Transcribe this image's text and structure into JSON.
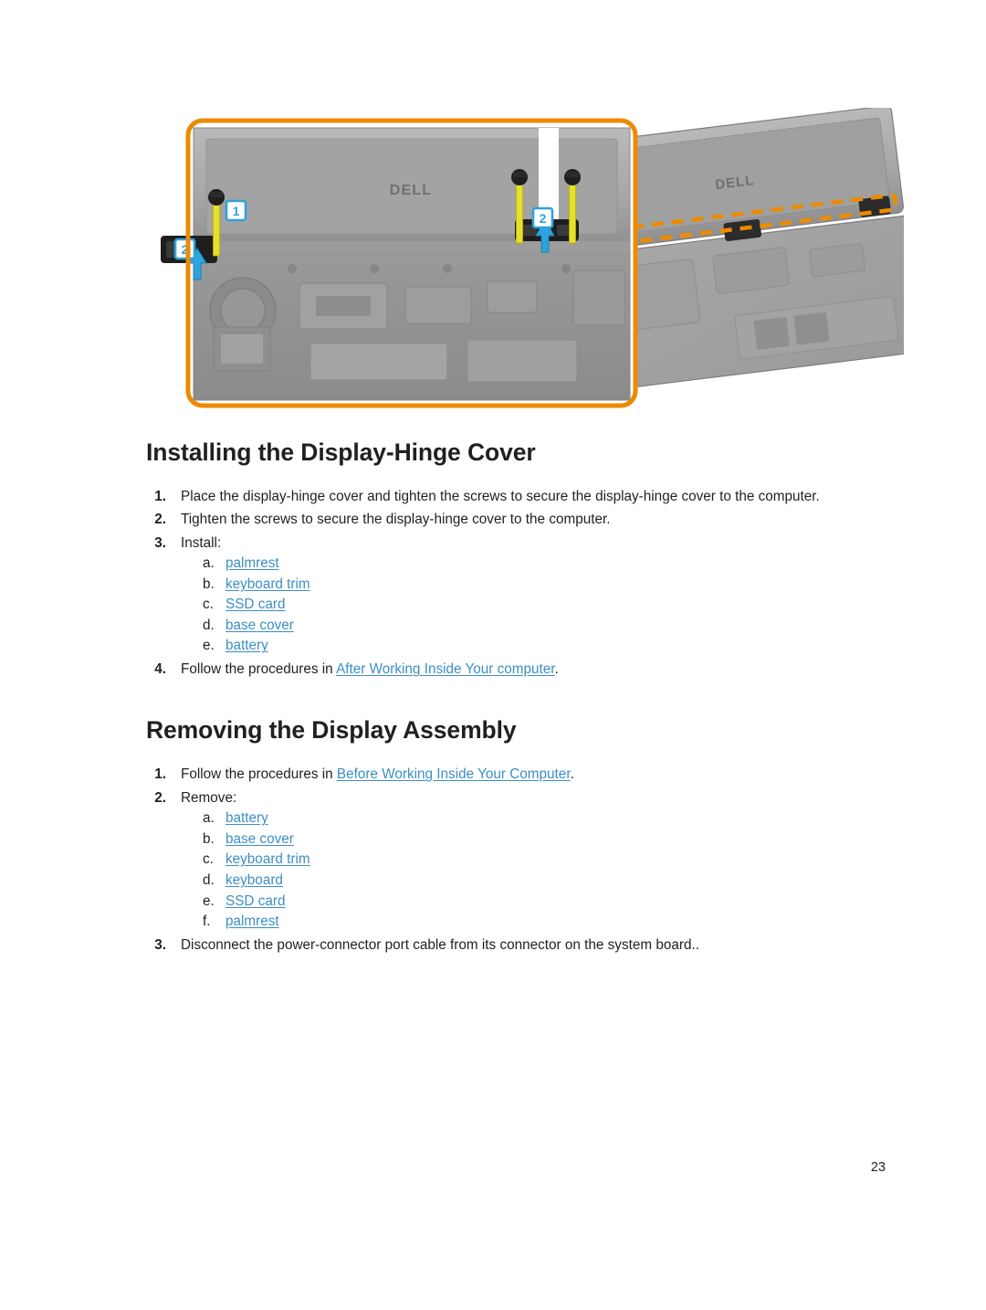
{
  "document": {
    "page_number": "23"
  },
  "figure": {
    "caption_none": "",
    "callouts": [
      "1",
      "2",
      "2"
    ],
    "brand_label": "DⵌLL",
    "highlight_color": "#ED8B00",
    "callout_color": "#2EA3DC",
    "arrow_color": "#2EA3DC"
  },
  "sections": [
    {
      "title": "Installing the Display-Hinge Cover",
      "steps": [
        {
          "num": "1.",
          "text": "Place the display-hinge cover and tighten the screws to secure the display-hinge cover to the computer."
        },
        {
          "num": "2.",
          "text": "Tighten the screws to secure the display-hinge cover to the computer."
        },
        {
          "num": "3.",
          "text": "Install:",
          "sub": [
            {
              "alpha": "a.",
              "link": "palmrest"
            },
            {
              "alpha": "b.",
              "link": "keyboard trim"
            },
            {
              "alpha": "c.",
              "link": "SSD card"
            },
            {
              "alpha": "d.",
              "link": "base cover"
            },
            {
              "alpha": "e.",
              "link": "battery"
            }
          ]
        },
        {
          "num": "4.",
          "pre": "Follow the procedures in ",
          "link": "After Working Inside Your computer",
          "post": "."
        }
      ]
    },
    {
      "title": "Removing the Display Assembly",
      "steps": [
        {
          "num": "1.",
          "pre": "Follow the procedures in ",
          "link": "Before Working Inside Your Computer",
          "post": "."
        },
        {
          "num": "2.",
          "text": "Remove:",
          "sub": [
            {
              "alpha": "a.",
              "link": "battery"
            },
            {
              "alpha": "b.",
              "link": "base cover"
            },
            {
              "alpha": "c.",
              "link": "keyboard trim"
            },
            {
              "alpha": "d.",
              "link": "keyboard"
            },
            {
              "alpha": "e.",
              "link": "SSD card"
            },
            {
              "alpha": "f.",
              "link": "palmrest"
            }
          ]
        },
        {
          "num": "3.",
          "text": "Disconnect the power-connector port cable from its connector on the system board.."
        }
      ]
    }
  ]
}
